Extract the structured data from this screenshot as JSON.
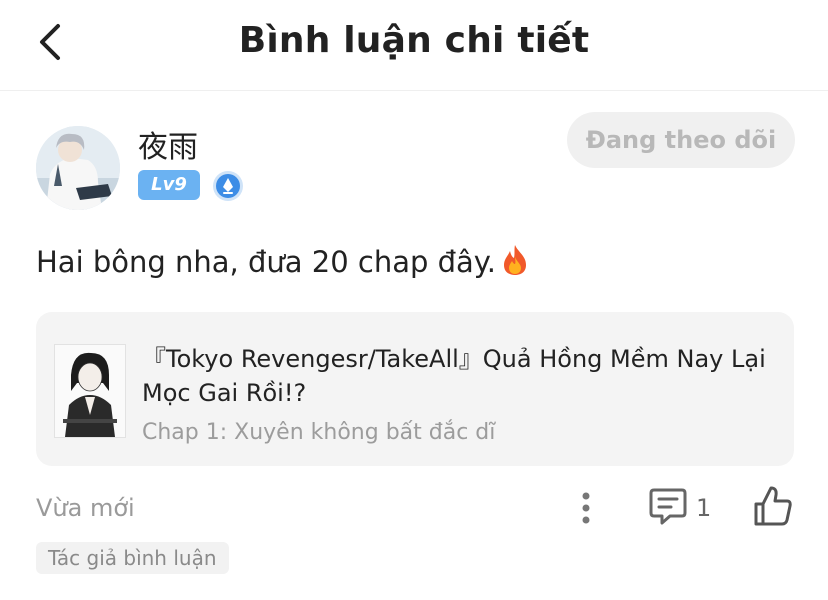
{
  "header": {
    "title": "Bình luận chi tiết"
  },
  "user": {
    "name": "夜雨",
    "level": "Lv9",
    "follow_label": "Đang theo dõi"
  },
  "comment": {
    "text": "Hai bông nha, đưa 20 chap đây."
  },
  "manga_card": {
    "title": "『Tokyo Revengesr/TakeAll』Quả Hồng Mềm Nay Lại Mọc Gai Rồi!?",
    "chapter": "Chap 1: Xuyên không bất đắc dĩ"
  },
  "footer": {
    "time": "Vừa mới",
    "reply_count": "1",
    "author_tag": "Tác giả bình luận"
  },
  "icons": {
    "back": "chevron-left-icon",
    "vip": "diamond-badge-icon",
    "fire": "fire-emoji-icon",
    "more": "vertical-dots-icon",
    "reply": "comment-bubble-icon",
    "like": "thumbs-up-icon"
  },
  "colors": {
    "level_badge": "#6bb2f2",
    "vip_badge": "#3d8de6",
    "follow_bg": "#f0f0f0",
    "follow_text": "#b8b8b8"
  }
}
